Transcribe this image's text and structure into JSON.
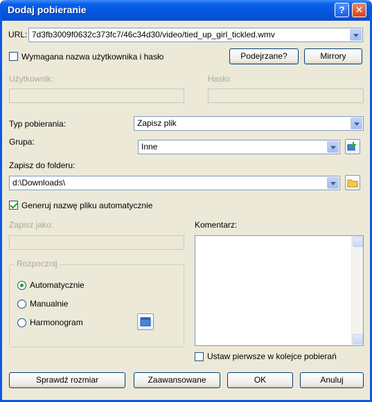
{
  "window": {
    "title": "Dodaj pobieranie",
    "help_label": "?",
    "close_label": "✕"
  },
  "url": {
    "label": "URL:",
    "value": "7d3fb3009f0632c373fc7/46c34d30/video/tied_up_girl_tickled.wmv"
  },
  "auth": {
    "required_label": "Wymagana nazwa użytkownika i hasło",
    "required_checked": false,
    "user_label": "Użytkownik:",
    "user_value": "",
    "password_label": "Hasło:",
    "password_value": ""
  },
  "buttons": {
    "suspicious": "Podejrzane?",
    "mirrors": "Mirrory",
    "check_size": "Sprawdź rozmiar",
    "advanced": "Zaawansowane",
    "ok": "OK",
    "cancel": "Anuluj"
  },
  "download_type": {
    "label": "Typ pobierania:",
    "value": "Zapisz plik"
  },
  "group": {
    "label": "Grupa:",
    "value": "Inne"
  },
  "save_folder": {
    "label": "Zapisz do folderu:",
    "value": "d:\\Downloads\\"
  },
  "generate_name": {
    "label": "Generuj nazwę pliku automatycznie",
    "checked": true
  },
  "save_as": {
    "label": "Zapisz jako:",
    "value": ""
  },
  "comment": {
    "label": "Komentarz:",
    "value": ""
  },
  "start": {
    "legend": "Rozpocznij",
    "options": [
      "Automatycznie",
      "Manualnie",
      "Harmonogram"
    ],
    "selected": "Automatycznie"
  },
  "queue_first": {
    "label": "Ustaw pierwsze w kolejce pobierań",
    "checked": false
  },
  "icons": {
    "dropdown": "chevron-down-icon",
    "add_group": "add-group-icon",
    "folder": "folder-icon",
    "schedule": "calendar-icon"
  }
}
